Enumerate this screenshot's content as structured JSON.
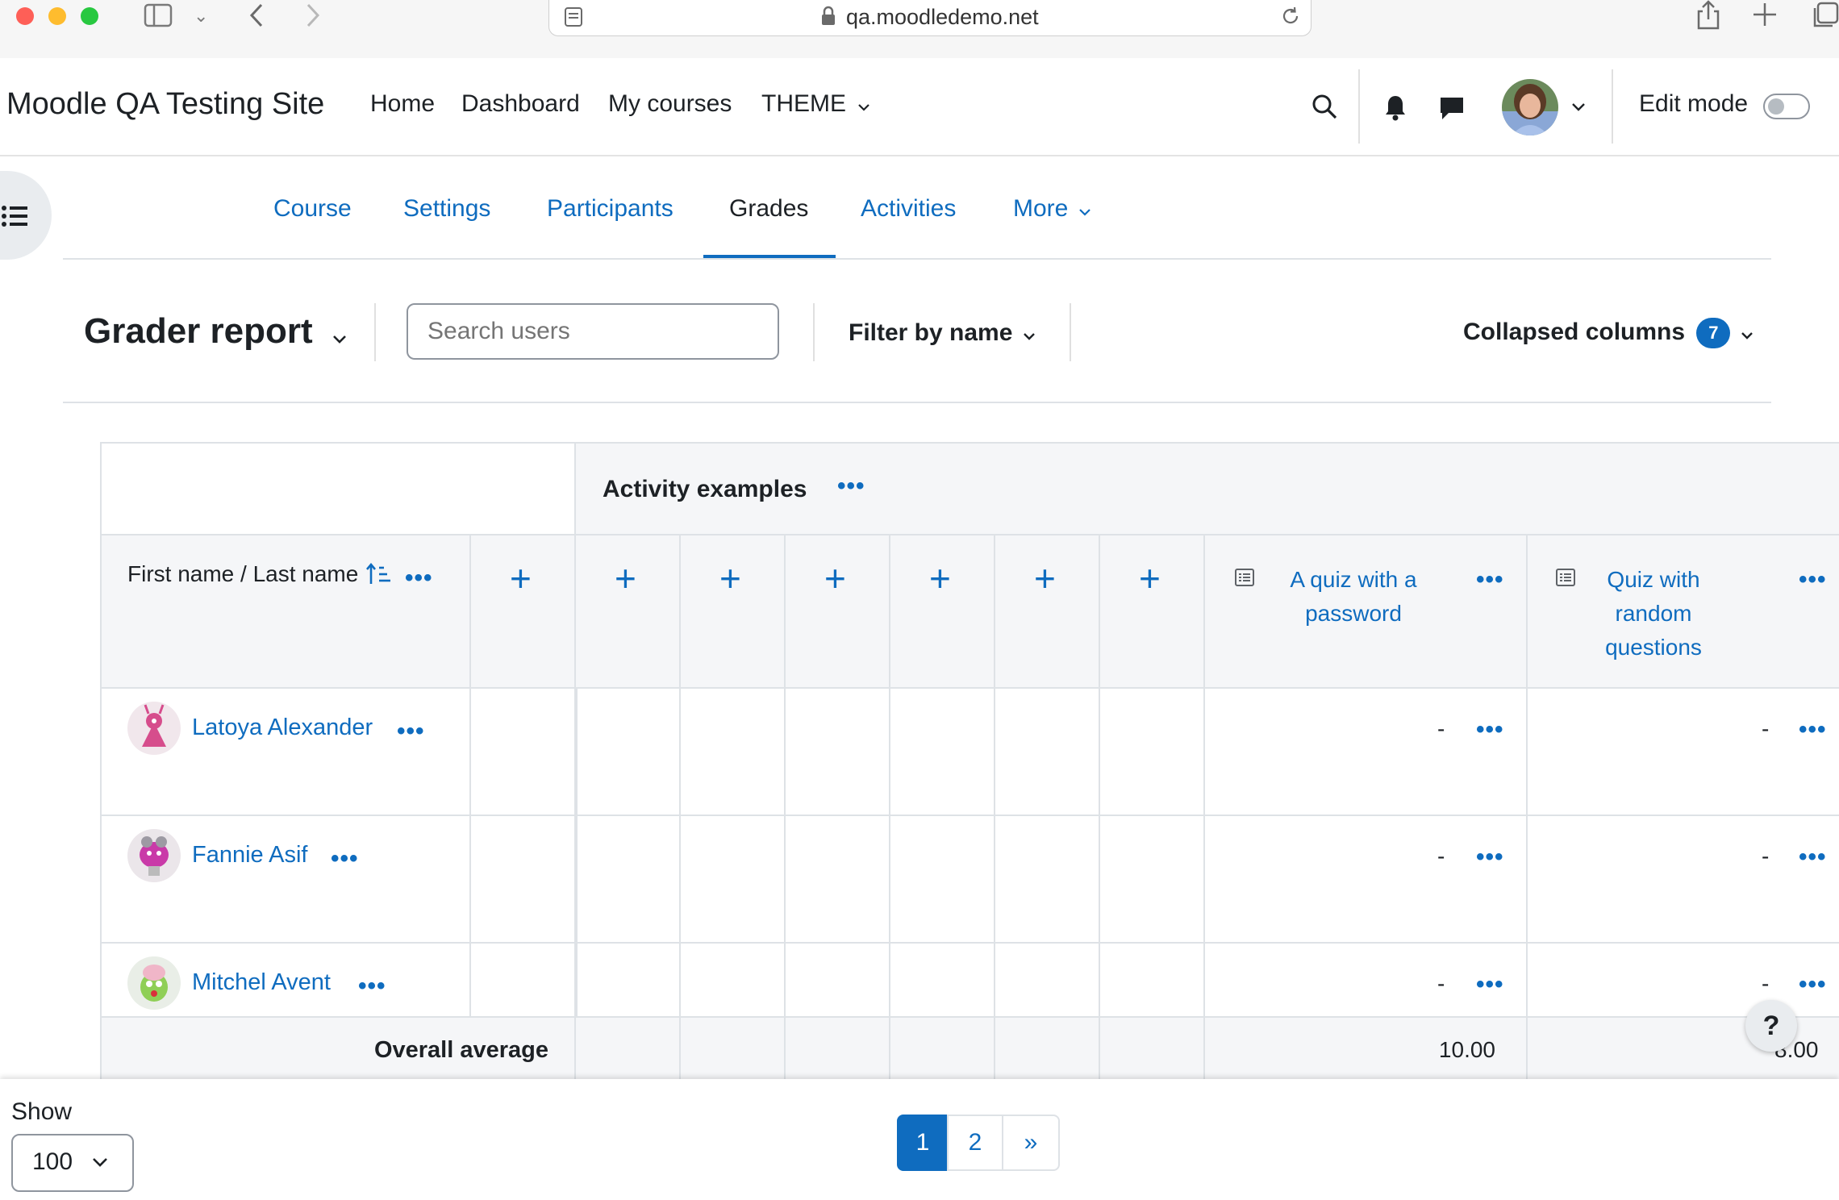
{
  "browser": {
    "url": "qa.moodledemo.net"
  },
  "navbar": {
    "site_name": "Moodle QA Testing Site",
    "links": [
      "Home",
      "Dashboard",
      "My courses",
      "THEME"
    ],
    "edit_mode_label": "Edit mode"
  },
  "course_nav": {
    "tabs": [
      "Course",
      "Settings",
      "Participants",
      "Grades",
      "Activities",
      "More"
    ],
    "active_tab": "Grades"
  },
  "toolbar": {
    "report_title": "Grader report",
    "search_placeholder": "Search users",
    "filter_label": "Filter by name",
    "collapsed_label": "Collapsed columns",
    "collapsed_count": "7"
  },
  "grader": {
    "category": "Activity examples",
    "name_header": "First name / Last name",
    "quiz1": [
      "A quiz with a",
      "password"
    ],
    "quiz2": [
      "Quiz with",
      "random",
      "questions"
    ],
    "students": [
      {
        "name": "Latoya Alexander",
        "grade1": "-",
        "grade2": "-"
      },
      {
        "name": "Fannie Asif",
        "grade1": "-",
        "grade2": "-"
      },
      {
        "name": "Mitchel Avent",
        "grade1": "-",
        "grade2": "-"
      }
    ],
    "overall_label": "Overall average",
    "overall1": "10.00",
    "overall2": "8.00"
  },
  "footer": {
    "show_label": "Show",
    "per_page": "100",
    "pages": [
      "1",
      "2",
      "»"
    ],
    "help": "?"
  }
}
